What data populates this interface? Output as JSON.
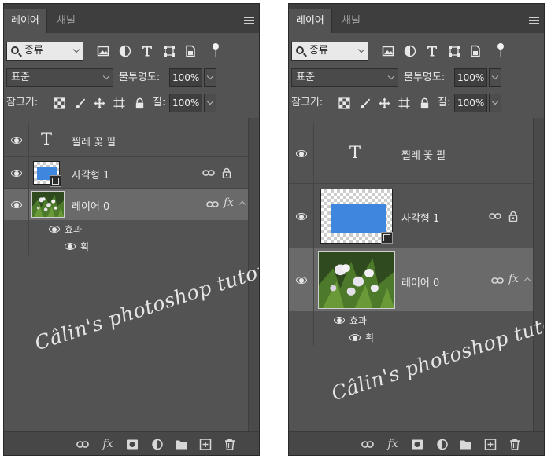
{
  "panel": {
    "tabs": [
      {
        "label": "레이어"
      },
      {
        "label": "채널"
      }
    ],
    "filter": {
      "selected": "종류"
    },
    "blend_mode": "표준",
    "opacity_label": "불투명도:",
    "opacity_value": "100%",
    "lock_label": "잠그기:",
    "fill_label": "칠:",
    "fill_value": "100%",
    "layers": [
      {
        "name": "찔레 꽃 필",
        "kind": "text"
      },
      {
        "name": "사각형 1",
        "kind": "shape"
      },
      {
        "name": "레이어 0",
        "kind": "image",
        "selected": true
      }
    ],
    "effects_label": "효과",
    "effect_item": "획",
    "fx_label": "fx"
  },
  "watermark": "Câlin's photoshop tutorial",
  "colors": {
    "panel_bg": "#535353",
    "selected_row": "#6a6a6a",
    "shape_fill": "#3f86de",
    "tab_bar": "#3e3e3e"
  }
}
